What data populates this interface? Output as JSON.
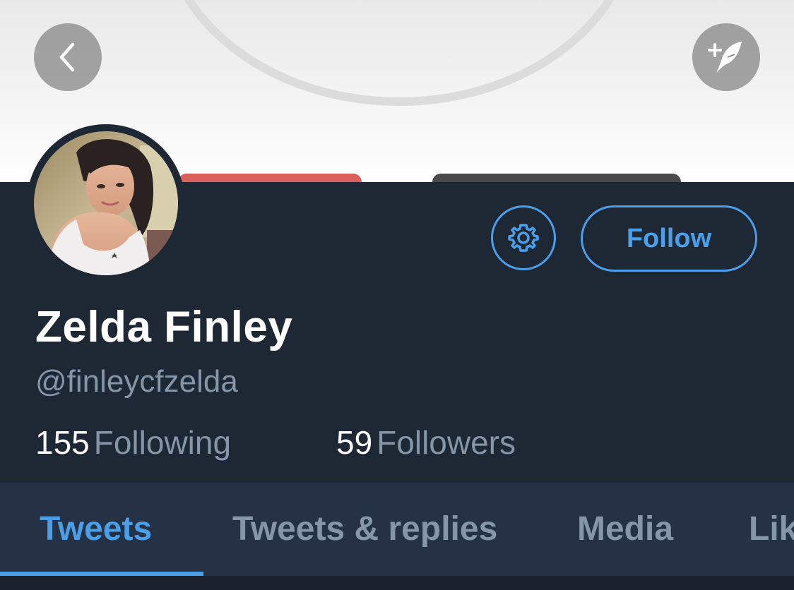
{
  "header": {
    "back_icon": "chevron-left-icon",
    "compose_icon": "compose-tweet-icon"
  },
  "profile": {
    "display_name": "Zelda Finley",
    "handle": "@finleycfzelda",
    "following_count": "155",
    "following_label": "Following",
    "followers_count": "59",
    "followers_label": "Followers",
    "follow_label": "Follow",
    "settings_icon": "gear-icon"
  },
  "tabs": [
    {
      "label": "Tweets",
      "active": true
    },
    {
      "label": "Tweets & replies",
      "active": false
    },
    {
      "label": "Media",
      "active": false
    },
    {
      "label": "Lik",
      "active": false
    }
  ],
  "colors": {
    "accent": "#4a9fe8",
    "background": "#1e2734",
    "tab_bar": "#253245",
    "muted_text": "#8596a8"
  }
}
